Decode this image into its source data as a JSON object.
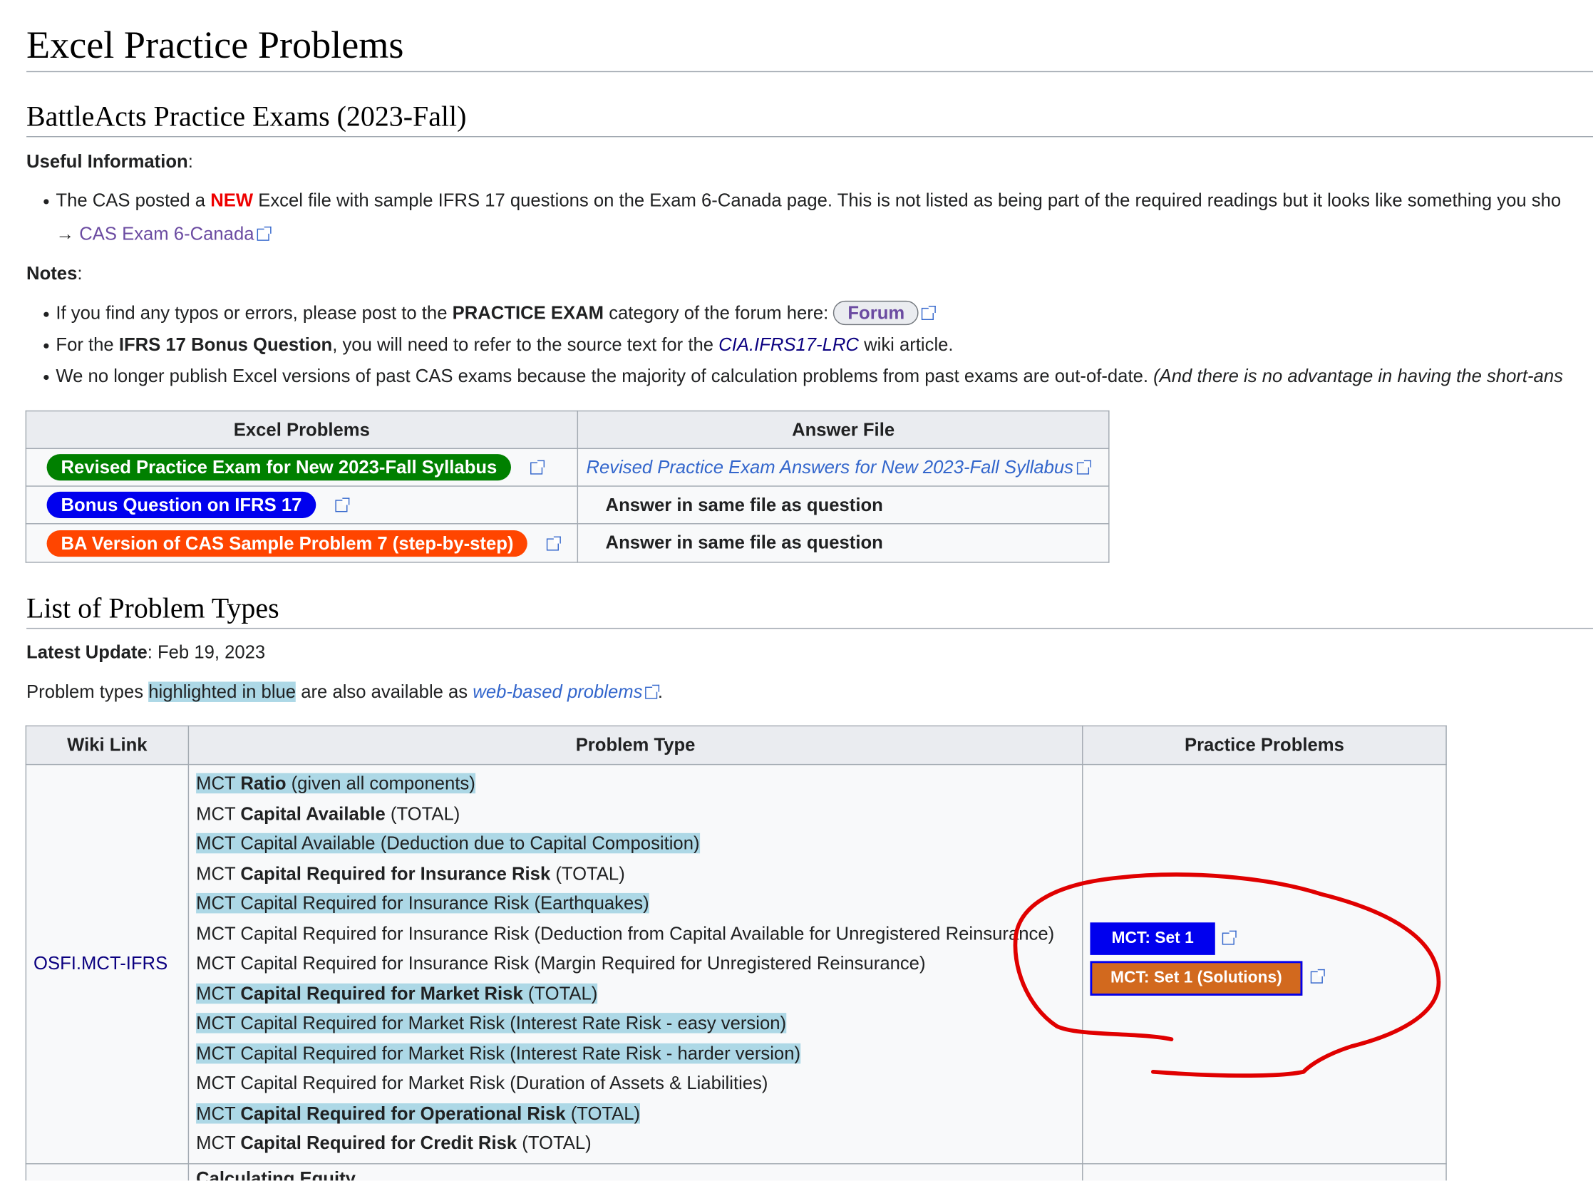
{
  "page": {
    "title": "Excel Practice Problems"
  },
  "section1": {
    "heading": "BattleActs Practice Exams (2023-Fall)",
    "useful_info_label": "Useful Information",
    "useful_info_colon": ":",
    "bullet1_pre": "The CAS posted a",
    "bullet1_new": "NEW",
    "bullet1_post": "Excel file with sample IFRS 17 questions on the Exam 6-Canada page. This is not listed as being part of the required readings but it looks like something you sho",
    "arrow": "→",
    "cas_link": "CAS Exam 6-Canada",
    "notes_label": "Notes",
    "notes_colon": ":",
    "note1_pre": "If you find any typos or errors, please post to the",
    "note1_bold": "PRACTICE EXAM",
    "note1_post": "category of the forum here:",
    "forum_button": "Forum",
    "note2_pre": "For the",
    "note2_bold": "IFRS 17 Bonus Question",
    "note2_mid": ", you will need to refer to the source text for the",
    "note2_link": "CIA.IFRS17-LRC",
    "note2_post": "wiki article.",
    "note3": "We no longer publish Excel versions of past CAS exams because the majority of calculation problems from past exams are out-of-date.",
    "note3_italic": "(And there is no advantage in having the short-ans"
  },
  "exam_table": {
    "headers": [
      "Excel Problems",
      "Answer File"
    ],
    "rows": [
      {
        "button": "Revised Practice Exam for New 2023-Fall Syllabus",
        "color": "#008000",
        "answer": "Revised Practice Exam Answers for New 2023-Fall Syllabus"
      },
      {
        "button": "Bonus Question on IFRS 17",
        "color": "#0000ee",
        "answer": "Answer in same file as question"
      },
      {
        "button": "BA Version of CAS Sample Problem 7 (step-by-step)",
        "color": "#ff4500",
        "answer": "Answer in same file as question"
      }
    ]
  },
  "section2": {
    "heading": "List of Problem Types",
    "latest_label": "Latest Update",
    "latest_value": ": Feb 19, 2023",
    "avail_pre": "Problem types",
    "avail_hl": "highlighted in blue",
    "avail_mid": "are also available as",
    "avail_link": "web-based problems",
    "avail_post": "."
  },
  "types_table": {
    "headers": [
      "Wiki Link",
      "Problem Type",
      "Practice Problems"
    ],
    "wiki_link": "OSFI.MCT-IFRS",
    "problem_types": [
      {
        "pre": "MCT ",
        "bold": "Ratio",
        "post": " (given all components)",
        "hl": true
      },
      {
        "pre": "MCT ",
        "bold": "Capital Available",
        "post": " (TOTAL)",
        "hl": false
      },
      {
        "pre": "MCT Capital Available (Deduction due to Capital Composition)",
        "bold": "",
        "post": "",
        "hl": true
      },
      {
        "pre": "MCT ",
        "bold": "Capital Required for Insurance Risk",
        "post": " (TOTAL)",
        "hl": false
      },
      {
        "pre": "MCT Capital Required for Insurance Risk (Earthquakes)",
        "bold": "",
        "post": "",
        "hl": true
      },
      {
        "pre": "MCT Capital Required for Insurance Risk (Deduction from Capital Available for Unregistered Reinsurance)",
        "bold": "",
        "post": "",
        "hl": false
      },
      {
        "pre": "MCT Capital Required for Insurance Risk (Margin Required for Unregistered Reinsurance)",
        "bold": "",
        "post": "",
        "hl": false
      },
      {
        "pre": "MCT ",
        "bold": "Capital Required for Market Risk",
        "post": " (TOTAL)",
        "hl": true
      },
      {
        "pre": "MCT Capital Required for Market Risk (Interest Rate Risk - easy version)",
        "bold": "",
        "post": "",
        "hl": true
      },
      {
        "pre": "MCT Capital Required for Market Risk (Interest Rate Risk - harder version)",
        "bold": "",
        "post": "",
        "hl": true
      },
      {
        "pre": "MCT Capital Required for Market Risk (Duration of Assets & Liabilities)",
        "bold": "",
        "post": "",
        "hl": false
      },
      {
        "pre": "MCT ",
        "bold": "Capital Required for Operational Risk",
        "post": " (TOTAL)",
        "hl": true
      },
      {
        "pre": "MCT ",
        "bold": "Capital Required for Credit Risk",
        "post": " (TOTAL)",
        "hl": false
      }
    ],
    "practice_buttons": [
      {
        "label": "MCT: Set 1",
        "color": "#0000ee"
      },
      {
        "label": "MCT: Set 1 (Solutions)",
        "color": "#d2691e"
      }
    ],
    "next_row_partial": "Calculating Equity"
  },
  "annotation": {
    "stroke_color": "#e00000"
  }
}
